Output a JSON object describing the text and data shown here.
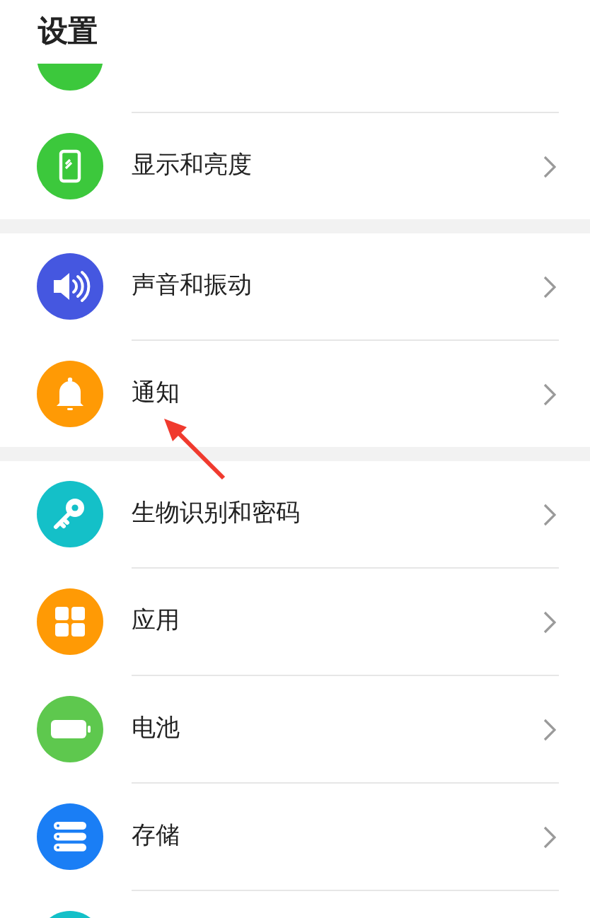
{
  "header": {
    "title": "设置"
  },
  "groups": [
    {
      "items": [
        {
          "kind": "cut",
          "color": "#3cc83c"
        },
        {
          "kind": "row",
          "color": "#3cc83c",
          "label": "显示和亮度"
        }
      ]
    },
    {
      "items": [
        {
          "kind": "row",
          "color": "#4557e0",
          "label": "声音和振动"
        },
        {
          "kind": "row",
          "color": "#ff9a05",
          "label": "通知"
        }
      ]
    },
    {
      "items": [
        {
          "kind": "row",
          "color": "#14c0c8",
          "label": "生物识别和密码"
        },
        {
          "kind": "row",
          "color": "#ff9a05",
          "label": "应用"
        },
        {
          "kind": "row",
          "color": "#5ec84e",
          "label": "电池"
        },
        {
          "kind": "row",
          "color": "#1a7ef5",
          "label": "存储"
        },
        {
          "kind": "cut",
          "color": "#14c0c8"
        }
      ]
    }
  ],
  "annotation": {
    "kind": "arrow",
    "color": "#f03a2e"
  }
}
